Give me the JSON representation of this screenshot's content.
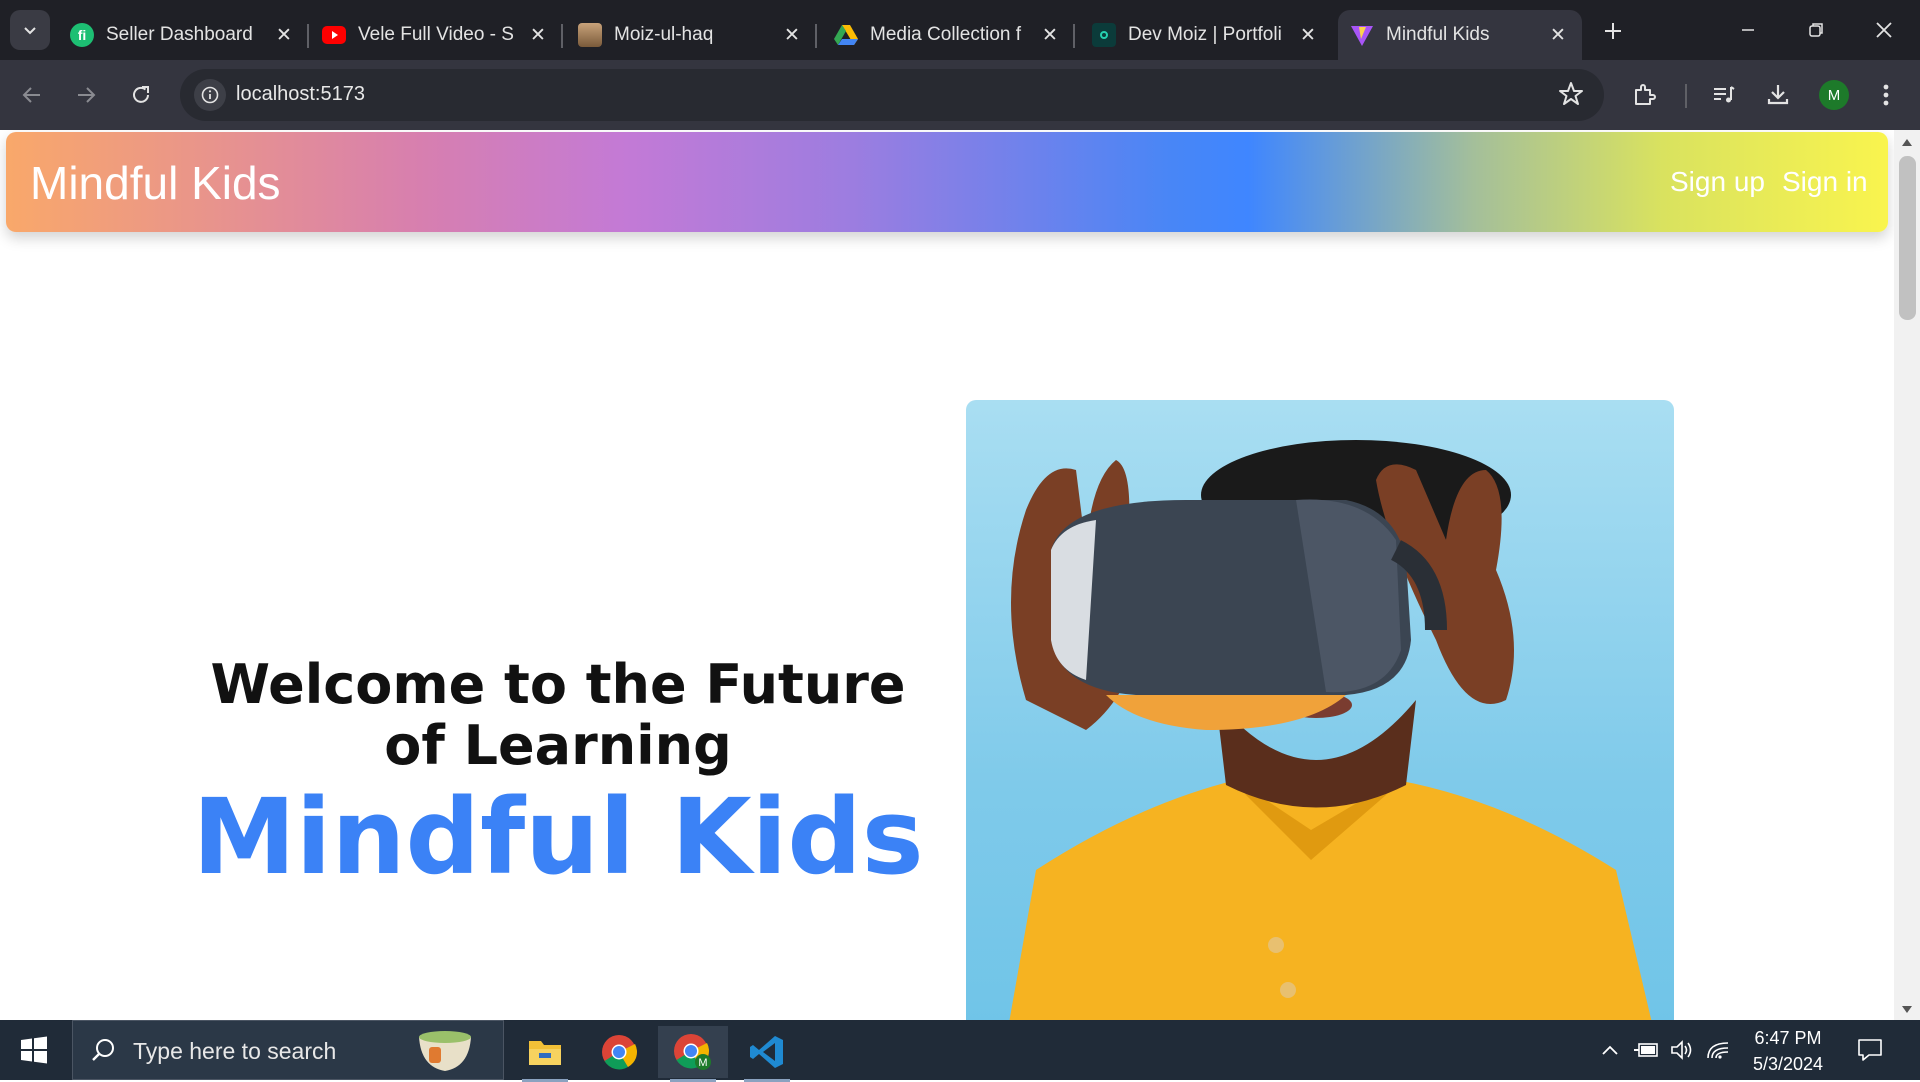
{
  "browser": {
    "tabs": [
      {
        "title": "Seller Dashboard",
        "icon": "fiverr-icon",
        "active": false
      },
      {
        "title": "Vele Full Video - S",
        "icon": "youtube-icon",
        "active": false
      },
      {
        "title": "Moiz-ul-haq",
        "icon": "profile-photo-icon",
        "active": false
      },
      {
        "title": "Media Collection f",
        "icon": "google-drive-icon",
        "active": false
      },
      {
        "title": "Dev Moiz | Portfoli",
        "icon": "portfolio-icon",
        "active": false
      },
      {
        "title": "Mindful Kids",
        "icon": "vite-icon",
        "active": true
      }
    ],
    "url": "localhost:5173",
    "profile_initial": "M"
  },
  "page": {
    "navbar": {
      "brand": "Mindful Kids",
      "links": [
        {
          "label": "Sign up"
        },
        {
          "label": "Sign in"
        }
      ]
    },
    "hero": {
      "title": "Welcome to the Future of Learning",
      "brand": "Mindful Kids",
      "image_icon": "vr-headset-child-photo"
    },
    "colors": {
      "brand_blue": "#3b82f6",
      "navbar_gradient": [
        "#f9a86a",
        "#c37ad6",
        "#3f86ff",
        "#f9f44e"
      ]
    }
  },
  "taskbar": {
    "search_placeholder": "Type here to search",
    "time": "6:47 PM",
    "date": "5/3/2024"
  }
}
